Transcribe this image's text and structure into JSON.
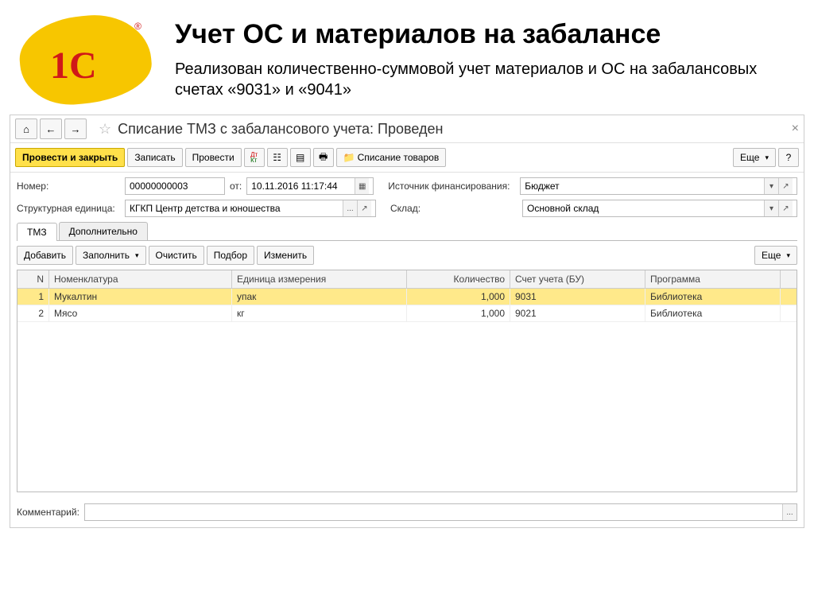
{
  "slide": {
    "title": "Учет ОС и материалов на забалансе",
    "subtitle": "Реализован количественно-суммовой учет материалов и ОС на забалансовых счетах «9031» и «9041»"
  },
  "logo": {
    "text": "1С",
    "reg": "®"
  },
  "nav": {
    "home": "⌂",
    "back": "←",
    "fwd": "→",
    "star": "☆",
    "title": "Списание ТМЗ с забалансового учета: Проведен",
    "close": "×"
  },
  "toolbar": {
    "primary": "Провести и закрыть",
    "save": "Записать",
    "run": "Провести",
    "goods": "Списание товаров",
    "more": "Еще",
    "help": "?"
  },
  "form": {
    "num_label": "Номер:",
    "num": "00000000003",
    "from_label": "от:",
    "date": "10.11.2016 11:17:44",
    "src_label": "Источник финансирования:",
    "src": "Бюджет",
    "struct_label": "Структурная единица:",
    "struct": "КГКП Центр детства и юношества",
    "wh_label": "Склад:",
    "wh": "Основной склад"
  },
  "tabs": {
    "tmz": "ТМЗ",
    "extra": "Дополнительно"
  },
  "tab_toolbar": {
    "add": "Добавить",
    "fill": "Заполнить",
    "clear": "Очистить",
    "pick": "Подбор",
    "change": "Изменить",
    "more": "Еще"
  },
  "grid": {
    "head": {
      "n": "N",
      "nom": "Номенклатура",
      "unit": "Единица измерения",
      "qty": "Количество",
      "acc": "Счет учета (БУ)",
      "prog": "Программа"
    },
    "rows": [
      {
        "n": "1",
        "nom": "Мукалтин",
        "unit": "упак",
        "qty": "1,000",
        "acc": "9031",
        "prog": "Библиотека"
      },
      {
        "n": "2",
        "nom": "Мясо",
        "unit": "кг",
        "qty": "1,000",
        "acc": "9021",
        "prog": "Библиотека"
      }
    ]
  },
  "comment": {
    "label": "Комментарий:",
    "btn": "..."
  }
}
